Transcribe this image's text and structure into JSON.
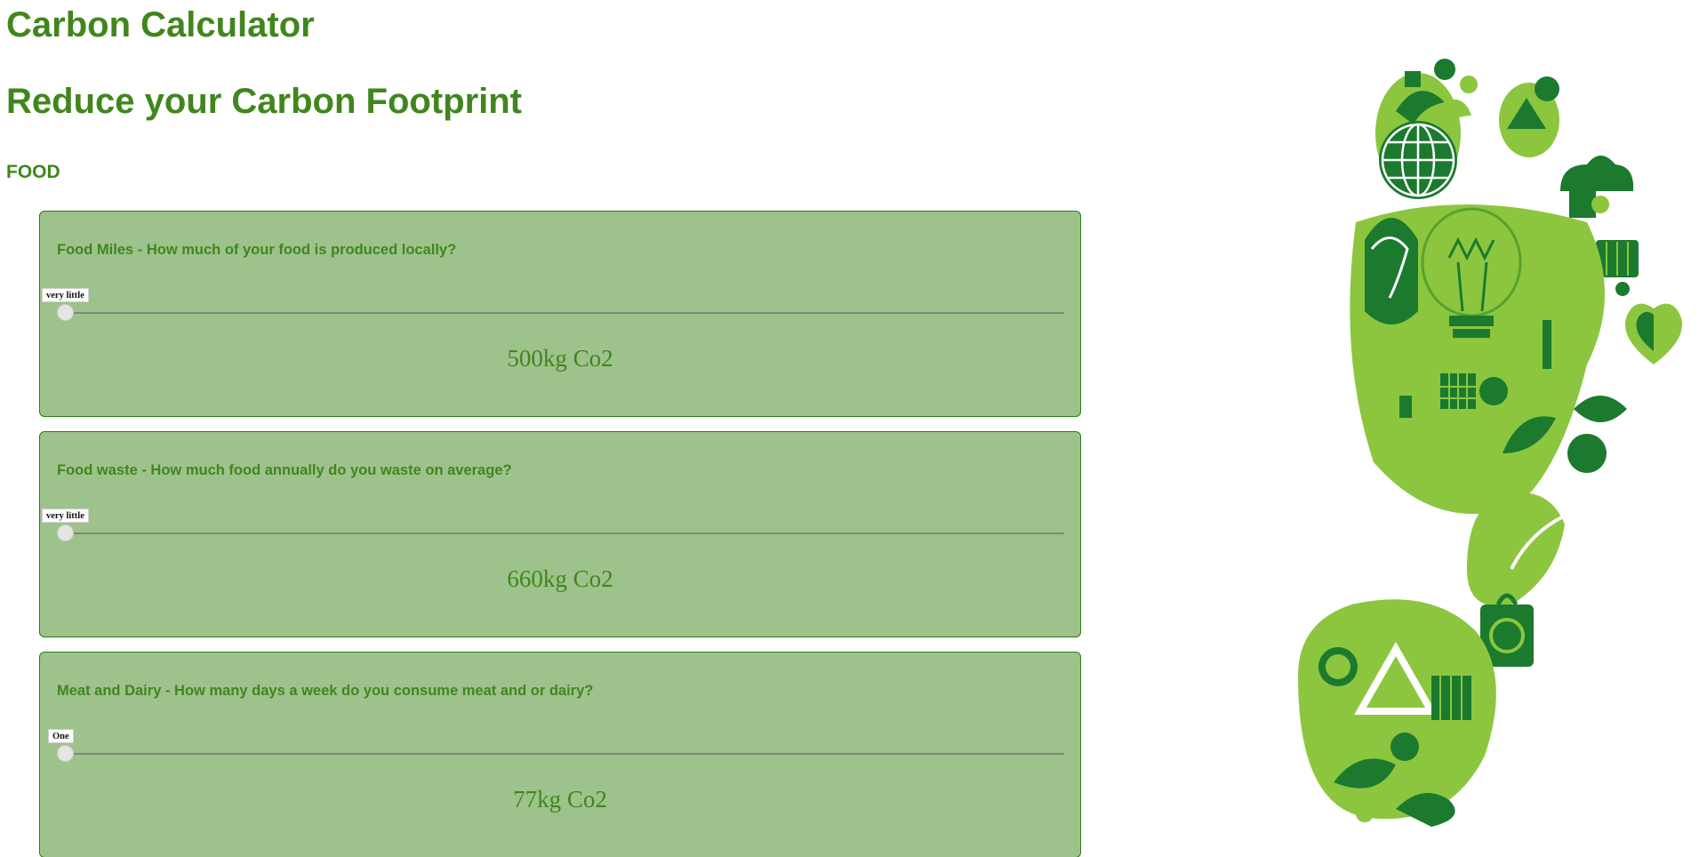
{
  "header": {
    "title": "Carbon Calculator",
    "subtitle": "Reduce your Carbon Footprint",
    "section": "FOOD"
  },
  "cards": [
    {
      "question": "Food Miles - How much of your food is produced locally?",
      "slider_label": "very little",
      "slider_value": 0,
      "result": "500kg Co2"
    },
    {
      "question": "Food waste - How much food annually do you waste on average?",
      "slider_label": "very little",
      "slider_value": 0,
      "result": "660kg Co2"
    },
    {
      "question": "Meat and Dairy - How many days a week do you consume meat and or dairy?",
      "slider_label": "One",
      "slider_value": 0,
      "result": "77kg Co2"
    }
  ],
  "colors": {
    "brand_green": "#40861d",
    "card_bg": "#9ec28c",
    "card_border": "#2d7a1a",
    "dark_green": "#1b7a2e",
    "light_green": "#8cc63f"
  },
  "image": {
    "icon": "eco-footprint-illustration"
  }
}
